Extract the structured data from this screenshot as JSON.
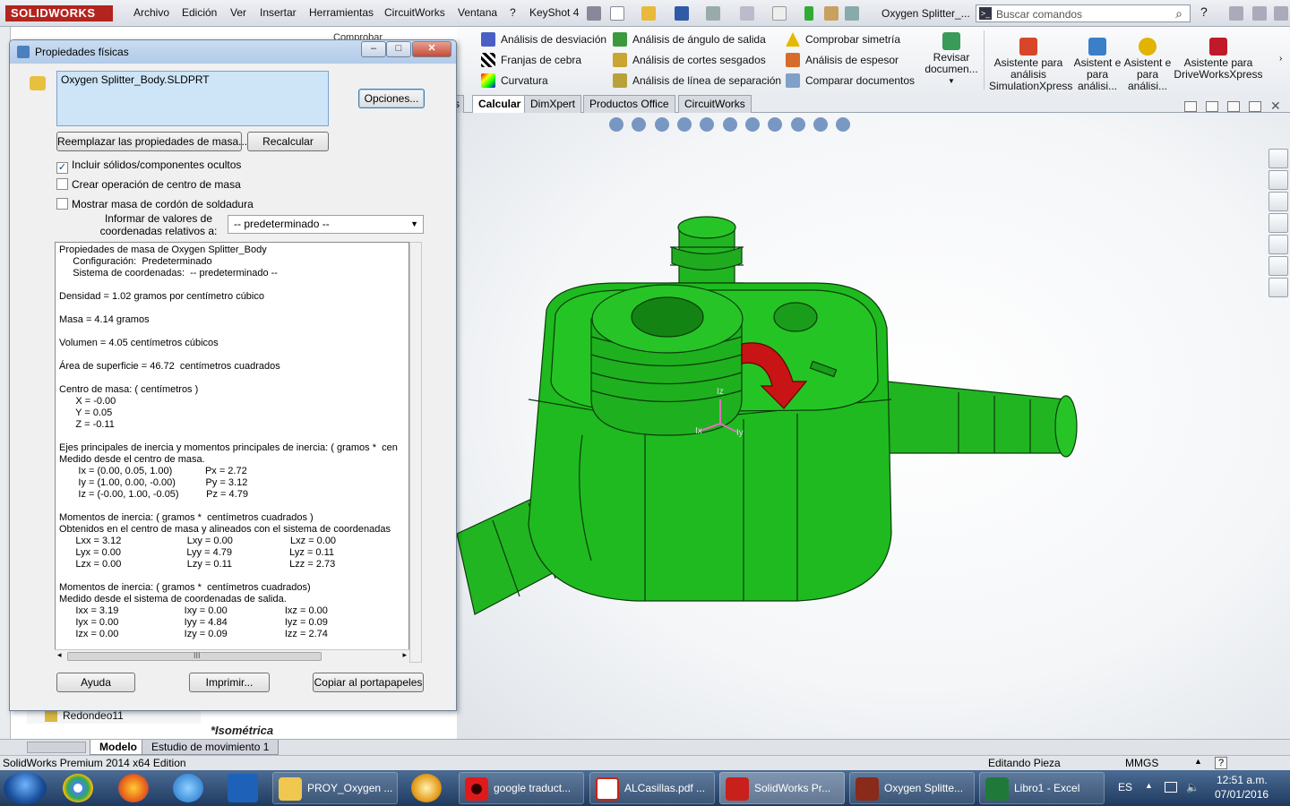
{
  "menubar": {
    "logo": "SOLIDWORKS",
    "items": [
      "Archivo",
      "Edición",
      "Ver",
      "Insertar",
      "Herramientas",
      "CircuitWorks",
      "Ventana",
      "?",
      "KeyShot 4"
    ],
    "doc_title": "Oxygen Splitter_...",
    "search_placeholder": "Buscar comandos"
  },
  "command_manager": {
    "col1": [
      "Análisis de desviación",
      "Franjas de cebra",
      "Curvatura"
    ],
    "col2": [
      "Análisis de ángulo de salida",
      "Análisis de cortes sesgados",
      "Análisis de línea de separación"
    ],
    "col3": [
      "Comprobar simetría",
      "Análisis de espesor",
      "Comparar documentos"
    ],
    "revisar": "Revisar documen...",
    "big": [
      {
        "label": "Asistente para análisis SimulationXpress"
      },
      {
        "label": "Asistent e para análisi..."
      },
      {
        "label": "Asistent e para análisi..."
      },
      {
        "label": "Asistente para DriveWorksXpress"
      }
    ]
  },
  "tabs": [
    "Calcular",
    "DimXpert",
    "Productos Office",
    "CircuitWorks"
  ],
  "tabs_partial": "s",
  "tab_active": "Calcular",
  "dialog": {
    "title": "Propiedades físicas",
    "part_name": "Oxygen Splitter_Body.SLDPRT",
    "options_btn": "Opciones...",
    "replace_btn": "Reemplazar las propiedades de masa...",
    "recalc_btn": "Recalcular",
    "chk_hidden": "Incluir sólidos/componentes ocultos",
    "chk_center": "Crear operación de centro de masa",
    "chk_weld": "Mostrar masa de cordón de soldadura",
    "coord_label": "Informar de valores de coordenadas relativos a:",
    "coord_value": "-- predeterminado --",
    "help_btn": "Ayuda",
    "print_btn": "Imprimir...",
    "copy_btn": "Copiar al portapapeles",
    "results": [
      "Propiedades de masa de Oxygen Splitter_Body",
      "     Configuración:  Predeterminado",
      "     Sistema de coordenadas:  -- predeterminado --",
      "",
      "Densidad = 1.02 gramos por centímetro cúbico",
      "",
      "Masa = 4.14 gramos",
      "",
      "Volumen = 4.05 centímetros cúbicos",
      "",
      "Área de superficie = 46.72  centímetros cuadrados",
      "",
      "Centro de masa: ( centímetros )",
      "      X = -0.00",
      "      Y = 0.05",
      "      Z = -0.11",
      "",
      "Ejes principales de inercia y momentos principales de inercia: ( gramos *  cen",
      "Medido desde el centro de masa.",
      "       Ix = (0.00, 0.05, 1.00)            Px = 2.72",
      "       Iy = (1.00, 0.00, -0.00)           Py = 3.12",
      "       Iz = (-0.00, 1.00, -0.05)          Pz = 4.79",
      "",
      "Momentos de inercia: ( gramos *  centímetros cuadrados )",
      "Obtenidos en el centro de masa y alineados con el sistema de coordenadas",
      "      Lxx = 3.12                        Lxy = 0.00                     Lxz = 0.00",
      "      Lyx = 0.00                        Lyy = 4.79                     Lyz = 0.11",
      "      Lzx = 0.00                        Lzy = 0.11                     Lzz = 2.73",
      "",
      "Momentos de inercia: ( gramos *  centímetros cuadrados)",
      "Medido desde el sistema de coordenadas de salida.",
      "      Ixx = 3.19                        Ixy = 0.00                     Ixz = 0.00",
      "      Iyx = 0.00                        Iyy = 4.84                     Iyz = 0.09",
      "      Izx = 0.00                        Izy = 0.09                     Izz = 2.74"
    ],
    "scroll_grip": "III"
  },
  "feature_tree": {
    "item": "Redondeo11",
    "behind_label": "Comprobar"
  },
  "view_label": "*Isométrica",
  "bottom_tabs": [
    "Modelo",
    "Estudio de movimiento 1"
  ],
  "status": {
    "left": "SolidWorks Premium 2014 x64 Edition",
    "mid": "Editando Pieza",
    "units": "MMGS",
    "help": "?"
  },
  "taskbar": {
    "buttons": [
      "PROY_Oxygen ...",
      "google traduct...",
      "ALCasillas.pdf ...",
      "SolidWorks Pr...",
      "Oxygen Splitte...",
      "Libro1 - Excel"
    ],
    "lang": "ES",
    "time": "12:51 a.m.",
    "date": "07/01/2016"
  },
  "axes": {
    "z": "Iz",
    "x": "Ix",
    "y": "Iy"
  },
  "colors": {
    "part": "#1fba1f",
    "arrow": "#c81414",
    "title_bar": "#b9cfea"
  }
}
